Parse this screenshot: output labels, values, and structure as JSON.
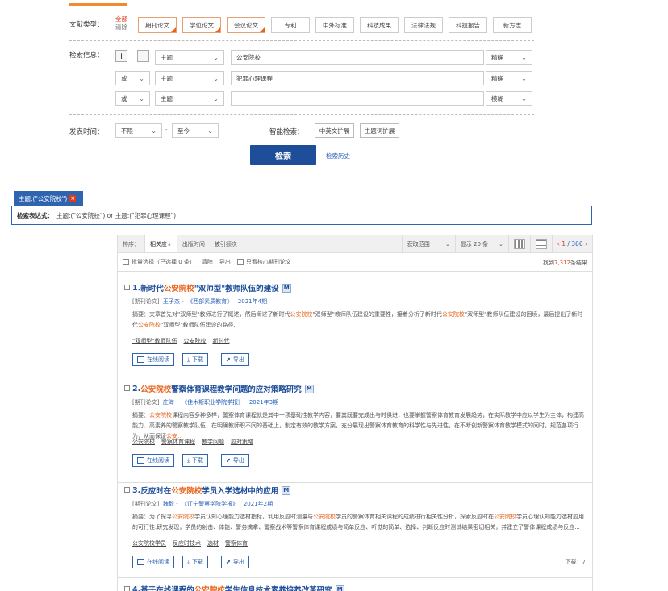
{
  "doc_type": {
    "label": "文献类型：",
    "all": "全部",
    "clear": "清除",
    "types": [
      {
        "label": "期刊论文",
        "selected": true
      },
      {
        "label": "学位论文",
        "selected": true
      },
      {
        "label": "会议论文",
        "selected": true
      },
      {
        "label": "专利",
        "selected": false
      },
      {
        "label": "中外标准",
        "selected": false
      },
      {
        "label": "科技成果",
        "selected": false
      },
      {
        "label": "法律法规",
        "selected": false
      },
      {
        "label": "科技报告",
        "selected": false
      },
      {
        "label": "新方志",
        "selected": false
      }
    ]
  },
  "search_info": {
    "label": "检索信息：",
    "rows": [
      {
        "logic": "",
        "field": "主题",
        "value": "公安院校",
        "match": "精确"
      },
      {
        "logic": "或",
        "field": "主题",
        "value": "犯罪心理课程",
        "match": "精确"
      },
      {
        "logic": "或",
        "field": "主题",
        "value": "",
        "match": "模糊"
      }
    ]
  },
  "publish_time": {
    "label": "发表时间：",
    "from": "不限",
    "to": "至今",
    "dash": "-"
  },
  "smart": {
    "label": "智能检索：",
    "btn1": "中英文扩展",
    "btn2": "主题词扩展"
  },
  "search_button": "检索",
  "history_link": "检索历史",
  "tag": {
    "text": "主题:(\"公安院校\")",
    "close": "×"
  },
  "expression": {
    "label": "检索表达式：",
    "value": "主题:(\"公安院校\") or 主题:(\"犯罪心理课程\")"
  },
  "sortbar": {
    "sort_label": "排序：",
    "relevance": "相关度",
    "pub_time": "出版时间",
    "cited": "被引频次",
    "range": "获取范围",
    "show": "显示 20 条",
    "page_current": "1",
    "page_total": "366"
  },
  "toolrow": {
    "batch": "批量选择（已选择 0 条）",
    "clear": "清除",
    "export": "导出",
    "core": "只看核心期刊论文",
    "found_prefix": "找到",
    "found_count": "7,312",
    "found_suffix": "条结果"
  },
  "results": [
    {
      "no": "1.",
      "title_pre": "新时代",
      "title_hl": "公安院校",
      "title_post": "\"双师型\"教师队伍的建设",
      "type": "[期刊论文]",
      "author": "王子杰",
      "journal": "《西部素质教育》",
      "date": "2021年4期",
      "abstract_pre": "摘要：文章首先对\"双师型\"教师进行了概述，然后阐述了新时代",
      "abstract_hl1": "公安院校",
      "abstract_mid": "\"双师型\"教师队伍建设的重要性，接着分析了新时代",
      "abstract_hl2": "公安院校",
      "abstract_mid2": "\"双师型\"教师队伍建设的困境，最后提出了新时代",
      "abstract_hl3": "公安院校",
      "abstract_post": "\"双师型\"教师队伍建设的路径.",
      "keywords": [
        "\"双师型\"教师队伍",
        "公安院校",
        "新时代"
      ],
      "read": "在线阅读",
      "download": "下载",
      "export": "导出"
    },
    {
      "no": "2.",
      "title_pre": "",
      "title_hl": "公安院校",
      "title_post": "警察体育课程教学问题的应对策略研究",
      "type": "[期刊论文]",
      "author": "庄海",
      "journal": "《佳木斯职业学院学报》",
      "date": "2021年3期",
      "abstract_pre": "摘要：",
      "abstract_hl1": "公安院校",
      "abstract_mid": "课程内容多种多样，警察体育课程就是其中一项基础性教学内容，要其既要完成出与时俱进，也要掌握警察体育教育发展趋势，在实际教学中应以学生为主体，构建高能力、高素养的警察教学队伍，在明确教师职不同的基础上，制定有效的教学方案，充分展现出警察体育教育的科学性与先进性，在不断创新警察体育教学模式的同时，规范各项行为，从而保证",
      "abstract_hl2": "公安...",
      "abstract_mid2": "",
      "abstract_hl3": "",
      "abstract_post": "",
      "keywords": [
        "公安院校",
        "警察体育课程",
        "教学问题",
        "应对策略"
      ],
      "read": "在线阅读",
      "download": "下载",
      "export": "导出"
    },
    {
      "no": "3.",
      "title_pre": "反应时在",
      "title_hl": "公安院校",
      "title_post": "学员入学选材中的应用",
      "type": "[期刊论文]",
      "author": "魏毅",
      "journal": "《辽宁警察学院学报》",
      "date": "2021年2期",
      "abstract_pre": "摘要：为了探寻",
      "abstract_hl1": "公安院校",
      "abstract_mid": "学员认知心理能力选材指标，利用反应时测量与",
      "abstract_hl2": "公安院校",
      "abstract_mid2": "学员的警察体育相关课程的成绩进行相关性分析，探索反应时在",
      "abstract_hl3": "公安院校",
      "abstract_post": "学员心理认知能力选材应用的可行性.研究发现，学员的射击、体能、警务擒拿、警察战术等警察体育课程成绩与简单反应、听觉的简单、选择、判断反应时测试结果密切相关，并建立了警体课程成绩与反应...",
      "keywords": [
        "公安院校学员",
        "反应时技术",
        "选材",
        "警察体育"
      ],
      "read": "在线阅读",
      "download": "下载",
      "export": "导出",
      "downloads_label": "下载：7"
    }
  ],
  "next_partial": {
    "no": "4.",
    "title_pre": "基于在线课程的",
    "title_hl": "公安院校",
    "title_post": "学生信息技术素养培养改革研究"
  }
}
